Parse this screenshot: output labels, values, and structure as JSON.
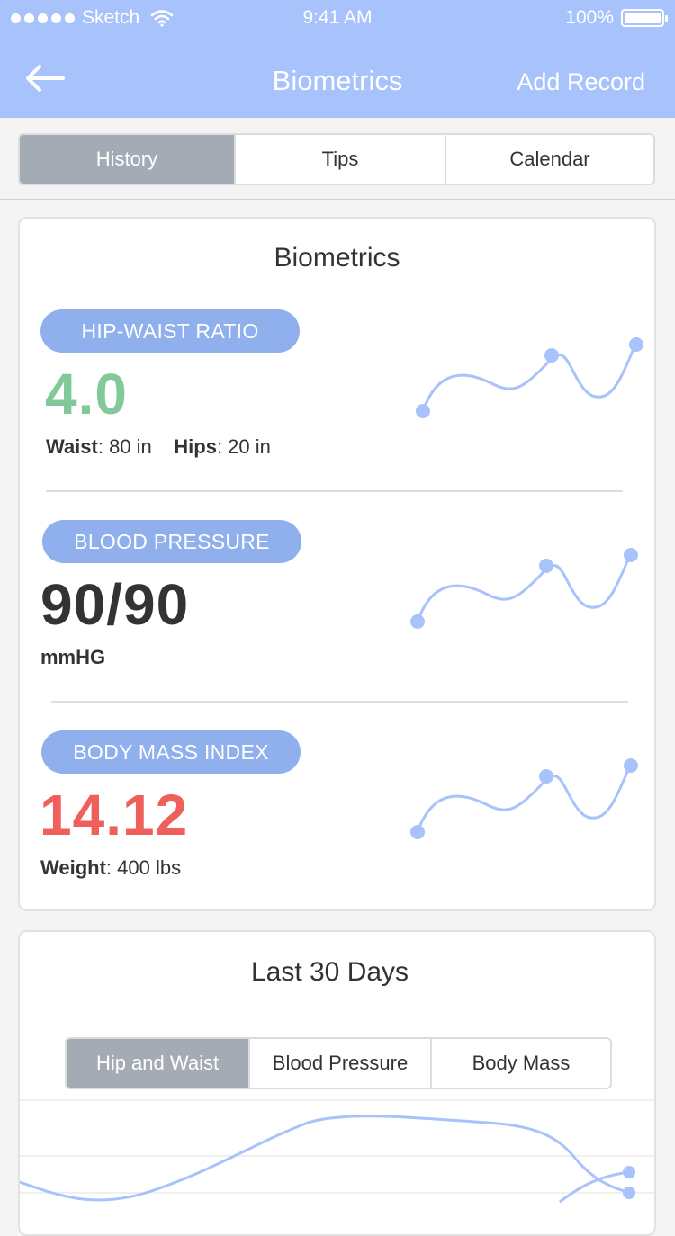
{
  "status_bar": {
    "carrier": "Sketch",
    "time": "9:41 AM",
    "battery": "100%"
  },
  "nav": {
    "title": "Biometrics",
    "action": "Add Record",
    "back_icon": "arrow-left-icon"
  },
  "tabs": [
    {
      "label": "History",
      "active": true
    },
    {
      "label": "Tips",
      "active": false
    },
    {
      "label": "Calendar",
      "active": false
    }
  ],
  "biometrics": {
    "title": "Biometrics",
    "hip_waist": {
      "label": "HIP-WAIST RATIO",
      "value": "4.0",
      "value_color": "#82c99a",
      "waist_label": "Waist",
      "waist_value": ": 80 in",
      "hips_label": "Hips",
      "hips_value": ": 20 in"
    },
    "blood_pressure": {
      "label": "BLOOD PRESSURE",
      "value": "90/90",
      "value_color": "#333333",
      "unit": "mmHG"
    },
    "bmi": {
      "label": "BODY MASS INDEX",
      "value": "14.12",
      "value_color": "#f0605a",
      "weight_label": "Weight",
      "weight_value": ": 400 lbs"
    },
    "accent": "#a8c3fb"
  },
  "last30": {
    "title": "Last 30 Days",
    "tabs": [
      {
        "label": "Hip and Waist",
        "active": true
      },
      {
        "label": "Blood Pressure",
        "active": false
      },
      {
        "label": "Body Mass",
        "active": false
      }
    ]
  }
}
